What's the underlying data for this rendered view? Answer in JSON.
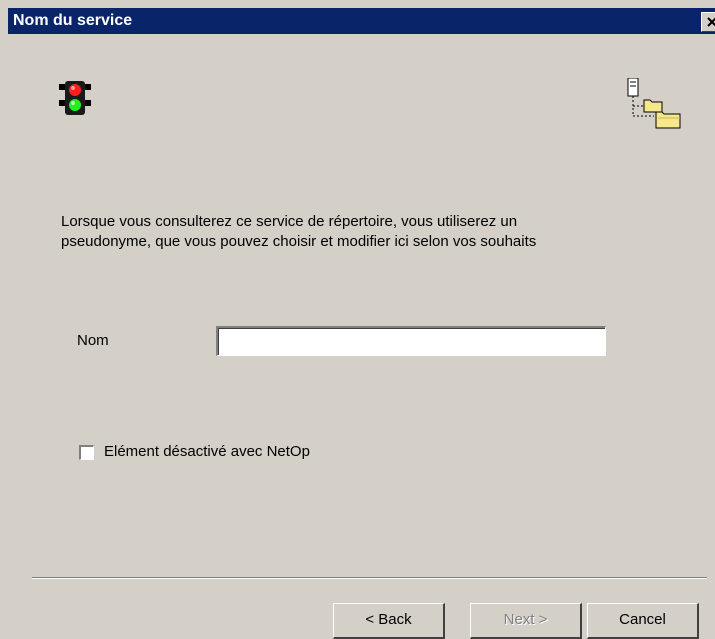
{
  "window": {
    "title": "Nom du service",
    "close_glyph": "close-icon"
  },
  "icons": {
    "left": "traffic-light-icon",
    "right": "directory-folders-icon"
  },
  "description": {
    "line1": "Lorsque vous consulterez ce service de répertoire, vous utiliserez un",
    "line2": "pseudonyme, que vous pouvez choisir et modifier ici selon vos souhaits"
  },
  "form": {
    "nom_label": "Nom",
    "nom_value": "",
    "checkbox_label": "Elément désactivé avec NetOp",
    "checkbox_checked": false
  },
  "buttons": {
    "back": "< Back",
    "next": "Next >",
    "cancel": "Cancel"
  }
}
